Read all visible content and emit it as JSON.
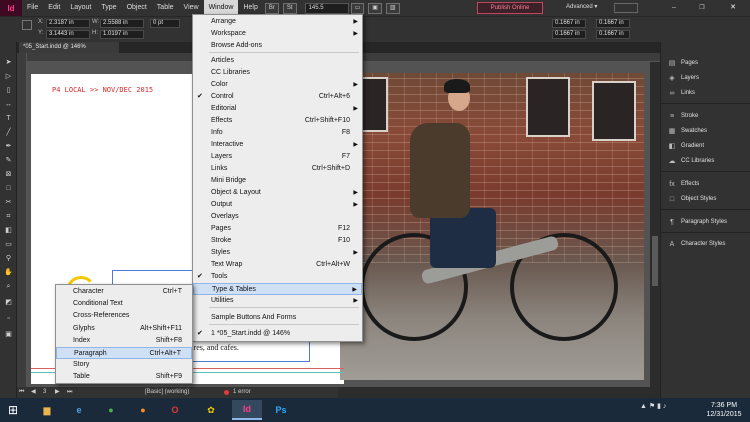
{
  "menubar": {
    "logo": "Id",
    "items": [
      "File",
      "Edit",
      "Layout",
      "Type",
      "Object",
      "Table",
      "View",
      "Window",
      "Help"
    ],
    "bridge_btn": "Br",
    "stock_btn": "St",
    "zoom": "145.5",
    "publish_label": "Publish Online",
    "workspace": "Advanced"
  },
  "control": {
    "x_label": "X:",
    "y_label": "Y:",
    "w_label": "W:",
    "h_label": "H:",
    "x": "2.3187 in",
    "y": "3.1443 in",
    "w": "2.5588 in",
    "h": "1.0197 in",
    "stroke": "0 pt",
    "right_1": "0.1667 in",
    "right_2": "0.1667 in"
  },
  "document": {
    "tab": "*05_Start.indd @ 146%",
    "slug": "P4  LOCAL >> NOV/DEC 2015",
    "body_text": "ares, and cafes."
  },
  "status": {
    "page": "3",
    "style": "[Basic] (working)",
    "errors": "1 error"
  },
  "panels": [
    {
      "icon": "pages-icon",
      "glyph": "▤",
      "label": "Pages"
    },
    {
      "icon": "layers-icon",
      "glyph": "◈",
      "label": "Layers"
    },
    {
      "icon": "links-icon",
      "glyph": "∞",
      "label": "Links"
    },
    {
      "icon": "stroke-icon",
      "glyph": "≡",
      "label": "Stroke"
    },
    {
      "icon": "swatches-icon",
      "glyph": "▦",
      "label": "Swatches"
    },
    {
      "icon": "gradient-icon",
      "glyph": "◧",
      "label": "Gradient"
    },
    {
      "icon": "cc-libraries-icon",
      "glyph": "☁",
      "label": "CC Libraries"
    },
    {
      "icon": "effects-icon",
      "glyph": "fx",
      "label": "Effects"
    },
    {
      "icon": "object-styles-icon",
      "glyph": "□",
      "label": "Object Styles"
    },
    {
      "icon": "paragraph-styles-icon",
      "glyph": "¶",
      "label": "Paragraph Styles"
    },
    {
      "icon": "character-styles-icon",
      "glyph": "A",
      "label": "Character Styles"
    }
  ],
  "window_menu": {
    "items": [
      {
        "label": "Arrange",
        "shortcut": "",
        "submenu": true,
        "checked": false
      },
      {
        "label": "Workspace",
        "shortcut": "",
        "submenu": true,
        "checked": false
      },
      {
        "label": "Browse Add-ons",
        "shortcut": "",
        "submenu": false,
        "checked": false
      },
      {
        "label": "Articles",
        "shortcut": "",
        "submenu": false,
        "checked": false
      },
      {
        "label": "CC Libraries",
        "shortcut": "",
        "submenu": false,
        "checked": false
      },
      {
        "label": "Color",
        "shortcut": "",
        "submenu": true,
        "checked": false
      },
      {
        "label": "Control",
        "shortcut": "Ctrl+Alt+6",
        "submenu": false,
        "checked": true
      },
      {
        "label": "Editorial",
        "shortcut": "",
        "submenu": true,
        "checked": false
      },
      {
        "label": "Effects",
        "shortcut": "Ctrl+Shift+F10",
        "submenu": false,
        "checked": false
      },
      {
        "label": "Info",
        "shortcut": "F8",
        "submenu": false,
        "checked": false
      },
      {
        "label": "Interactive",
        "shortcut": "",
        "submenu": true,
        "checked": false
      },
      {
        "label": "Layers",
        "shortcut": "F7",
        "submenu": false,
        "checked": false
      },
      {
        "label": "Links",
        "shortcut": "Ctrl+Shift+D",
        "submenu": false,
        "checked": false
      },
      {
        "label": "Mini Bridge",
        "shortcut": "",
        "submenu": false,
        "checked": false
      },
      {
        "label": "Object & Layout",
        "shortcut": "",
        "submenu": true,
        "checked": false
      },
      {
        "label": "Output",
        "shortcut": "",
        "submenu": true,
        "checked": false
      },
      {
        "label": "Overlays",
        "shortcut": "",
        "submenu": false,
        "checked": false
      },
      {
        "label": "Pages",
        "shortcut": "F12",
        "submenu": false,
        "checked": false
      },
      {
        "label": "Stroke",
        "shortcut": "F10",
        "submenu": false,
        "checked": false
      },
      {
        "label": "Styles",
        "shortcut": "",
        "submenu": true,
        "checked": false
      },
      {
        "label": "Text Wrap",
        "shortcut": "Ctrl+Alt+W",
        "submenu": false,
        "checked": false
      },
      {
        "label": "Tools",
        "shortcut": "",
        "submenu": false,
        "checked": true
      },
      {
        "label": "Type & Tables",
        "shortcut": "",
        "submenu": true,
        "checked": false
      },
      {
        "label": "Utilities",
        "shortcut": "",
        "submenu": true,
        "checked": false
      },
      {
        "label": "Sample Buttons And Forms",
        "shortcut": "",
        "submenu": false,
        "checked": false
      },
      {
        "label": "1 *05_Start.indd @ 146%",
        "shortcut": "",
        "submenu": false,
        "checked": true
      }
    ]
  },
  "type_tables_menu": {
    "items": [
      {
        "label": "Character",
        "shortcut": "Ctrl+T"
      },
      {
        "label": "Conditional Text",
        "shortcut": ""
      },
      {
        "label": "Cross-References",
        "shortcut": ""
      },
      {
        "label": "Glyphs",
        "shortcut": "Alt+Shift+F11"
      },
      {
        "label": "Index",
        "shortcut": "Shift+F8"
      },
      {
        "label": "Paragraph",
        "shortcut": "Ctrl+Alt+T"
      },
      {
        "label": "Story",
        "shortcut": ""
      },
      {
        "label": "Table",
        "shortcut": "Shift+F9"
      }
    ]
  },
  "taskbar": {
    "apps": [
      {
        "name": "file-explorer",
        "glyph": "▆",
        "color": "#e8b64a"
      },
      {
        "name": "internet-explorer",
        "glyph": "e",
        "color": "#4aa3e8"
      },
      {
        "name": "chrome",
        "glyph": "●",
        "color": "#4caf50"
      },
      {
        "name": "firefox",
        "glyph": "●",
        "color": "#ff8c1a"
      },
      {
        "name": "opera",
        "glyph": "O",
        "color": "#e53935"
      },
      {
        "name": "media-app",
        "glyph": "✿",
        "color": "#f2c800"
      },
      {
        "name": "indesign",
        "glyph": "Id",
        "color": "#ff3c8e"
      },
      {
        "name": "photoshop",
        "glyph": "Ps",
        "color": "#31a8ff"
      }
    ],
    "time": "7:36 PM",
    "date": "12/31/2015"
  },
  "colors": {
    "slug_red": "#d42a2a",
    "highlight": "#cfe0f5",
    "indesign_pink": "#ff3c8e"
  }
}
